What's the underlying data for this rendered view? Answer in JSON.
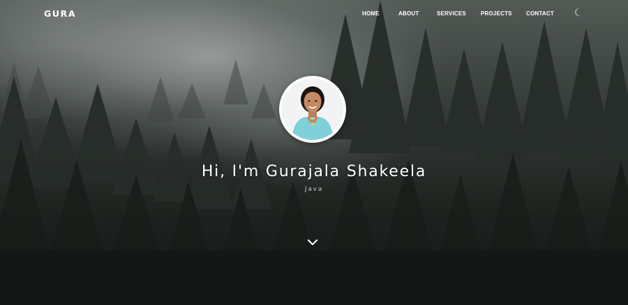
{
  "brand": {
    "name": "GURA"
  },
  "nav": {
    "home": "HOME",
    "about": "ABOUT",
    "services": "SERVICES",
    "projects": "PROJECTS",
    "contact": "CONTACT",
    "theme_toggle_icon": "moon-icon"
  },
  "hero": {
    "title": "Hi, I'm Gurajala Shakeela",
    "subtitle": "Java",
    "scroll_icon": "chevron-down-icon"
  },
  "colors": {
    "text": "#ffffff",
    "subtitle": "#c8ccc9",
    "forest_dark": "#1a1e1b",
    "mist": "#bec3c0"
  }
}
